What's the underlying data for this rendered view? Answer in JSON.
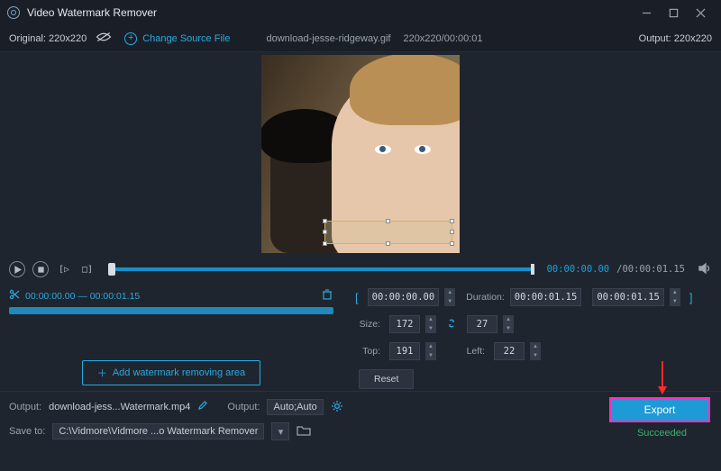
{
  "titlebar": {
    "title": "Video Watermark Remover"
  },
  "toolbar": {
    "original": "Original: 220x220",
    "change": "Change Source File",
    "filename": "download-jesse-ridgeway.gif",
    "dims_time": "220x220/00:00:01",
    "output": "Output: 220x220"
  },
  "playback": {
    "current": "00:00:00.00",
    "total": "/00:00:01.15"
  },
  "clip": {
    "range": "00:00:00.00 — 00:00:01.15",
    "add_button": "Add watermark removing area"
  },
  "params": {
    "start": "00:00:00.00",
    "duration_label": "Duration:",
    "duration_value": "00:00:01.15",
    "end": "00:00:01.15",
    "size_label": "Size:",
    "size_w": "172",
    "size_h": "27",
    "top_label": "Top:",
    "top_v": "191",
    "left_label": "Left:",
    "left_v": "22",
    "reset": "Reset"
  },
  "bottom": {
    "output_label": "Output:",
    "output_file": "download-jess...Watermark.mp4",
    "output_label2": "Output:",
    "output_preset": "Auto;Auto",
    "save_label": "Save to:",
    "save_path": "C:\\Vidmore\\Vidmore ...o Watermark Remover"
  },
  "export": "Export",
  "status": "Succeeded"
}
